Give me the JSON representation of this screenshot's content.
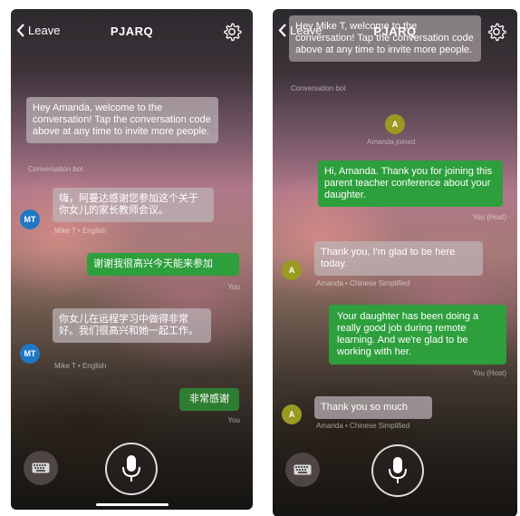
{
  "left": {
    "back_label": "Leave",
    "title": "PJARQ",
    "bot_message": "Hey Amanda, welcome to the conversation! Tap the conversation code above at any time to invite more people.",
    "bot_caption": "Conversation bot",
    "msg1_avatar": "MT",
    "msg1_text": "嗨，阿曼达感谢您参加这个关于你女儿的家长教师会议。",
    "msg1_caption": "Mike T • English",
    "you1_text": "谢谢我很高兴今天能来参加",
    "you1_caption": "You",
    "msg2_avatar": "MT",
    "msg2_text": "你女儿在远程学习中做得非常好。我们很高兴和她一起工作。",
    "msg2_caption": "Mike T • English",
    "you2_text": "非常感谢",
    "you2_caption": "You"
  },
  "right": {
    "back_label": "Leave",
    "title": "PJARQ",
    "bot_message_partial": "Hey Mike T, welcome to the conversation! Tap the conversation code above at any time to invite more people.",
    "bot_caption": "Conversation bot",
    "joined_avatar": "A",
    "joined_text": "Amanda joined",
    "host1_text": "Hi, Amanda. Thank you for joining this parent teacher conference about your daughter.",
    "host1_caption": "You (Host)",
    "a1_avatar": "A",
    "a1_text": "Thank you, I'm glad to be here today.",
    "a1_caption": "Amanda • Chinese Simplified",
    "host2_text": "Your daughter has been doing a really good job during remote learning. And we're glad to be working with her.",
    "host2_caption": "You (Host)",
    "a2_avatar": "A",
    "a2_text": "Thank you so much",
    "a2_caption": "Amanda • Chinese Simplified"
  },
  "colors": {
    "green_bubble": "#2d9f3c",
    "dark_green_bubble": "#2f7d31",
    "mt_avatar": "#1f78c4",
    "amanda_avatar": "#9a9a22"
  },
  "icons": [
    "chevron-left-icon",
    "gear-icon",
    "keyboard-icon",
    "microphone-icon"
  ]
}
